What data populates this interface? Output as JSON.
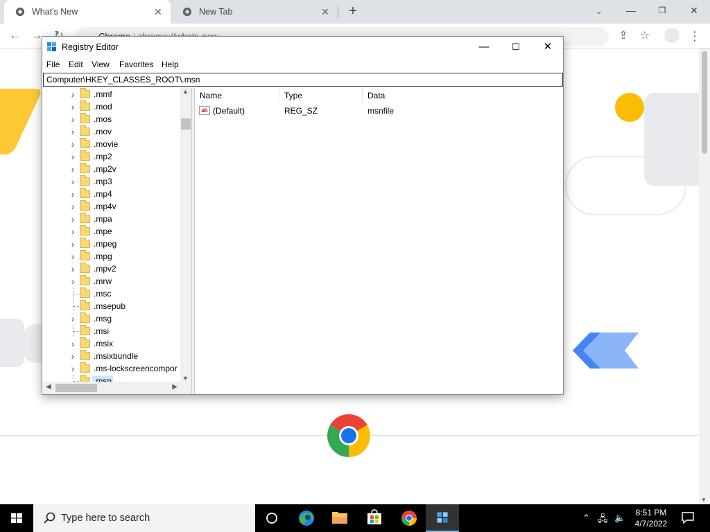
{
  "browser": {
    "tabs": [
      {
        "label": "What's New"
      },
      {
        "label": "New Tab"
      }
    ],
    "omnibox_site": "Chrome",
    "omnibox_url": "chrome://whats-new"
  },
  "regedit": {
    "title": "Registry Editor",
    "menu": [
      "File",
      "Edit",
      "View",
      "Favorites",
      "Help"
    ],
    "address": "Computer\\HKEY_CLASSES_ROOT\\.msn",
    "tree": [
      {
        "label": ".mmf",
        "expandable": true
      },
      {
        "label": ".mod",
        "expandable": true
      },
      {
        "label": ".mos",
        "expandable": true
      },
      {
        "label": ".mov",
        "expandable": true
      },
      {
        "label": ".movie",
        "expandable": true
      },
      {
        "label": ".mp2",
        "expandable": true
      },
      {
        "label": ".mp2v",
        "expandable": true
      },
      {
        "label": ".mp3",
        "expandable": true
      },
      {
        "label": ".mp4",
        "expandable": true
      },
      {
        "label": ".mp4v",
        "expandable": true
      },
      {
        "label": ".mpa",
        "expandable": true
      },
      {
        "label": ".mpe",
        "expandable": true
      },
      {
        "label": ".mpeg",
        "expandable": true
      },
      {
        "label": ".mpg",
        "expandable": true
      },
      {
        "label": ".mpv2",
        "expandable": true
      },
      {
        "label": ".mrw",
        "expandable": true
      },
      {
        "label": ".msc",
        "expandable": false
      },
      {
        "label": ".msepub",
        "expandable": false
      },
      {
        "label": ".msg",
        "expandable": true
      },
      {
        "label": ".msi",
        "expandable": false
      },
      {
        "label": ".msix",
        "expandable": true
      },
      {
        "label": ".msixbundle",
        "expandable": true
      },
      {
        "label": ".ms-lockscreencompor",
        "expandable": true
      },
      {
        "label": ".msn",
        "expandable": false,
        "selected": true
      }
    ],
    "columns": [
      "Name",
      "Type",
      "Data"
    ],
    "values": [
      {
        "name": "(Default)",
        "type": "REG_SZ",
        "data": "msnfile"
      }
    ]
  },
  "taskbar": {
    "search_placeholder": "Type here to search",
    "time": "8:51 PM",
    "date": "4/7/2022"
  }
}
